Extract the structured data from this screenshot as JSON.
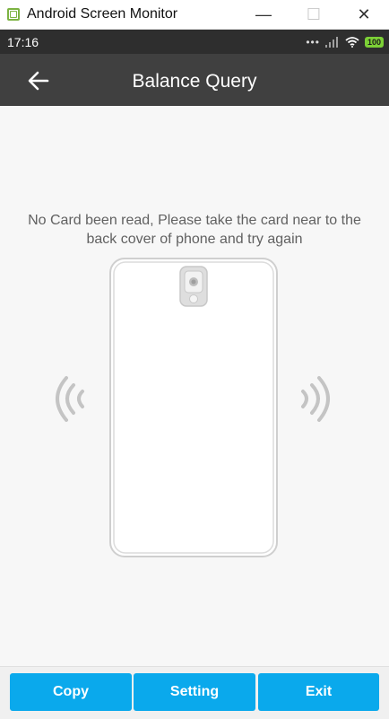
{
  "window": {
    "title": "Android Screen Monitor",
    "minimize_glyph": "—",
    "maximize_glyph": "☐",
    "close_glyph": "✕"
  },
  "status_bar": {
    "time": "17:16",
    "overflow_dots": "•••",
    "battery": "100",
    "icons": [
      "signal-icon",
      "wifi-icon",
      "battery-icon"
    ]
  },
  "app_bar": {
    "title": "Balance Query",
    "back_icon": "arrow-left-icon"
  },
  "main": {
    "message": "No Card been read, Please take the card near to the back cover of phone and try again",
    "illustration_icons": [
      "phone-back-icon",
      "camera-icon",
      "nfc-waves-left-icon",
      "nfc-waves-right-icon"
    ]
  },
  "buttons": {
    "copy": "Copy",
    "setting": "Setting",
    "exit": "Exit"
  },
  "colors": {
    "status_bar": "#2e2e2e",
    "app_bar": "#404040",
    "button": "#0aa9ec",
    "battery": "#7cd036",
    "content_bg": "#f7f7f7"
  }
}
